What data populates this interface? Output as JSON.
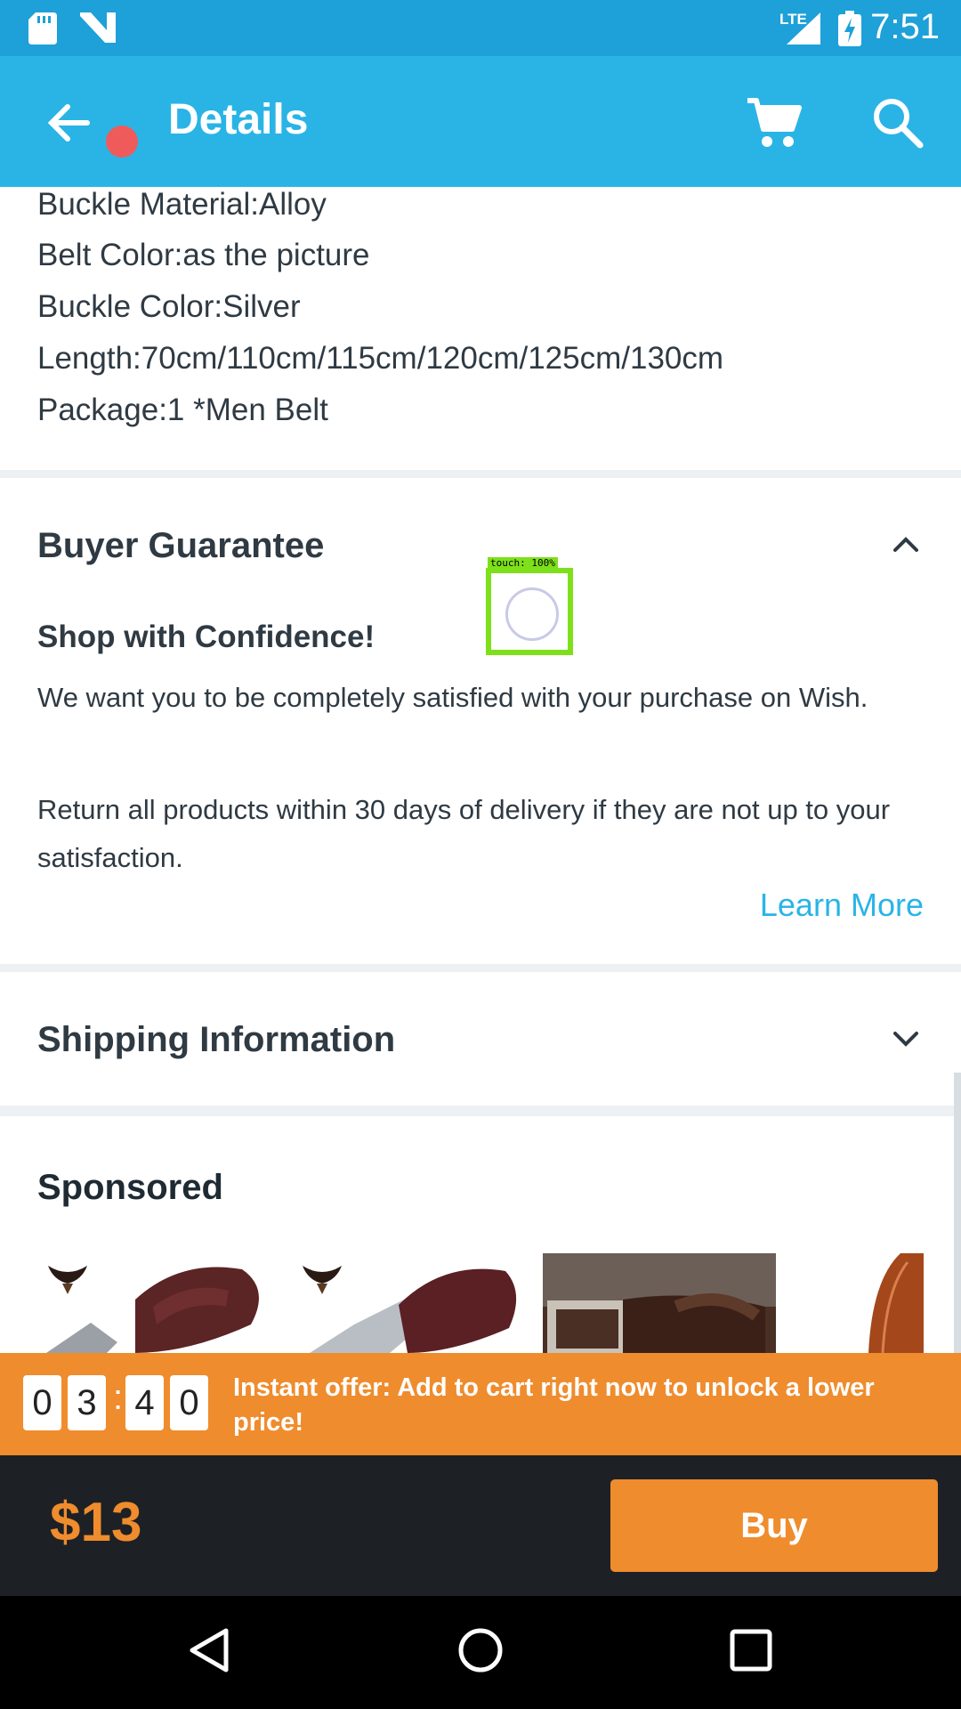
{
  "status_bar": {
    "time": "7:51",
    "network": "LTE"
  },
  "app_bar": {
    "title": "Details"
  },
  "specs": [
    "Buckle Material:Alloy",
    "Belt Color:as the picture",
    "Buckle Color:Silver",
    "Length:70cm/110cm/115cm/120cm/125cm/130cm",
    "Package:1 *Men Belt"
  ],
  "buyer_guarantee": {
    "title": "Buyer Guarantee",
    "subtitle": "Shop with Confidence!",
    "paragraph1": "We want you to be completely satisfied with your purchase on Wish.",
    "paragraph2": "Return all products within 30 days of delivery if they are not up to your satisfaction.",
    "learn_more": "Learn More"
  },
  "touch_indicator": "touch: 100%",
  "shipping": {
    "title": "Shipping Information"
  },
  "sponsored": {
    "title": "Sponsored"
  },
  "offer": {
    "timer": [
      "0",
      "3",
      "4",
      "0"
    ],
    "separator": ":",
    "message": "Instant offer: Add to cart right now to unlock a lower price!"
  },
  "buy_bar": {
    "price": "$13",
    "buy_label": "Buy"
  },
  "colors": {
    "accent": "#2ab4e6",
    "orange": "#ef8c2d",
    "dark": "#1d2125"
  }
}
